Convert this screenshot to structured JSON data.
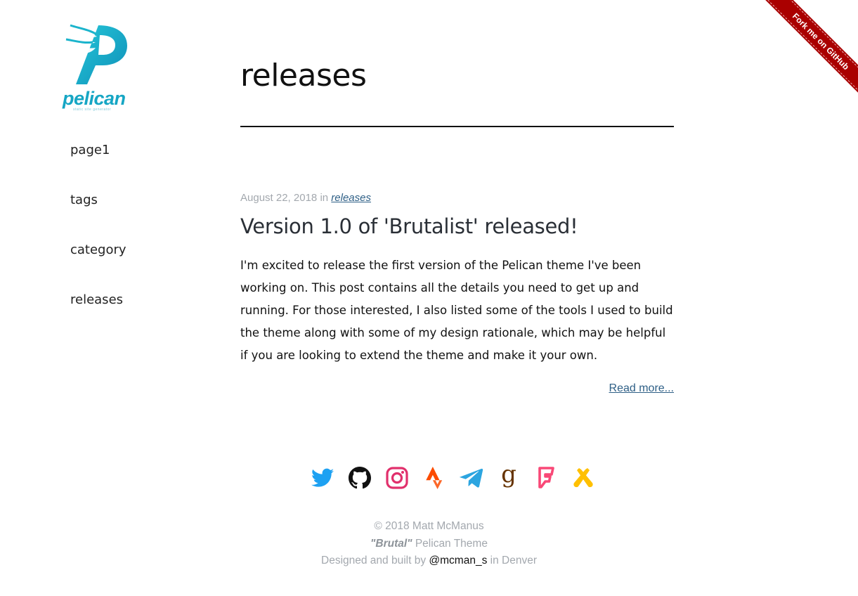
{
  "sidebar": {
    "logo": {
      "word": "pelican",
      "tagline": "static site generator"
    },
    "nav": [
      {
        "label": "page1"
      },
      {
        "label": "tags"
      },
      {
        "label": "category"
      },
      {
        "label": "releases"
      }
    ]
  },
  "main": {
    "page_title": "releases",
    "post": {
      "date": "August 22, 2018",
      "in_word": "in",
      "category": "releases",
      "title": "Version 1.0 of 'Brutalist' released!",
      "summary": "I'm excited to release the first version of the Pelican theme I've been working on. This post contains all the details you need to get up and running. For those interested, I also listed some of the tools I used to build the theme along with some of my design rationale, which may be helpful if you are looking to extend the theme and make it your own.",
      "read_more": "Read more..."
    }
  },
  "social": [
    {
      "name": "twitter-icon",
      "color": "#1da1f2"
    },
    {
      "name": "github-icon",
      "color": "#111111"
    },
    {
      "name": "instagram-icon",
      "color": "#e1306c"
    },
    {
      "name": "strava-icon",
      "color": "#fc4c02"
    },
    {
      "name": "telegram-icon",
      "color": "#2ca5e0"
    },
    {
      "name": "goodreads-icon",
      "color": "#663300"
    },
    {
      "name": "foursquare-icon",
      "color": "#f94877"
    },
    {
      "name": "untappd-icon",
      "color": "#ffc000"
    }
  ],
  "footer": {
    "copyright": "© 2018 Matt McManus",
    "theme_name": "\"Brutal\"",
    "theme_suffix": "Pelican Theme",
    "built_prefix": "Designed and built by",
    "handle": "@mcman_s",
    "built_suffix": "in Denver"
  },
  "ribbon": {
    "label": "Fork me on GitHub",
    "color": "#aa0000"
  },
  "colors": {
    "logo": "#16a6c4",
    "link": "#2e5f86",
    "muted": "#a3a8ae"
  }
}
